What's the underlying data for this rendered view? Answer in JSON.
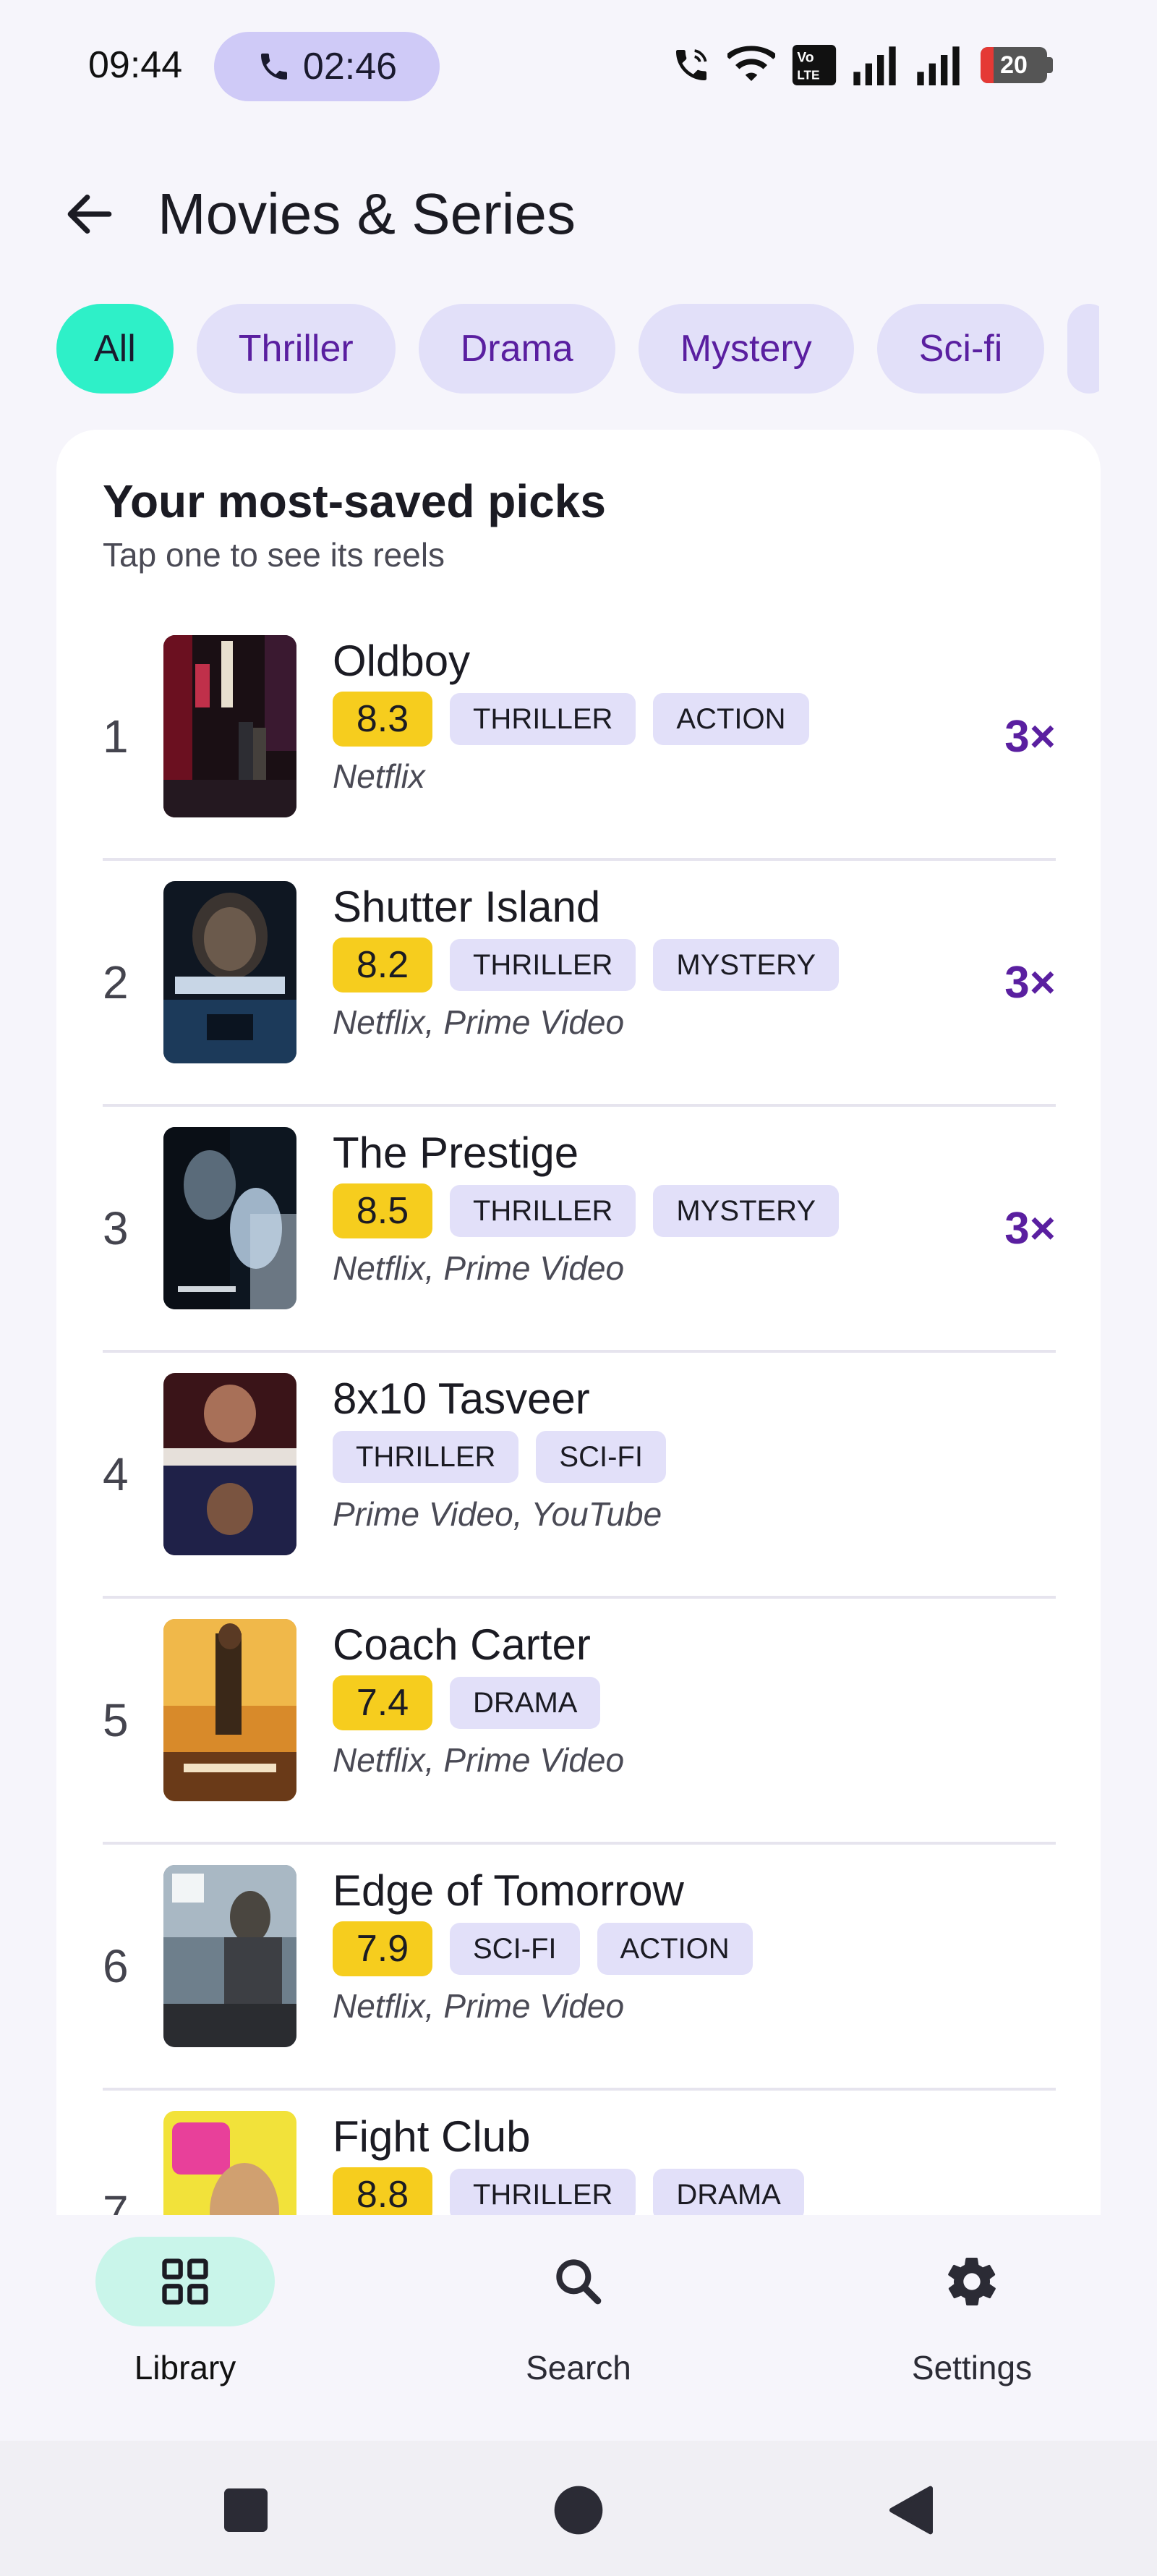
{
  "status_bar": {
    "time": "09:44",
    "call_timer": "02:46",
    "battery_level": "20",
    "battery_percent": 20,
    "colors": {
      "call_pill": "#cfcaf7",
      "battery_low": "#e53935"
    }
  },
  "header": {
    "title": "Movies & Series",
    "back_icon": "arrow-left-icon"
  },
  "filters": {
    "chips": [
      {
        "label": "All",
        "active": true
      },
      {
        "label": "Thriller",
        "active": false
      },
      {
        "label": "Drama",
        "active": false
      },
      {
        "label": "Mystery",
        "active": false
      },
      {
        "label": "Sci-fi",
        "active": false
      }
    ],
    "colors": {
      "active": "#2ef0c8",
      "inactive": "#e2e0f9",
      "text": "#5a1fa0"
    }
  },
  "card": {
    "title": "Your most-saved picks",
    "subtitle": "Tap one to see its reels"
  },
  "movies": [
    {
      "rank": "1",
      "title": "Oldboy",
      "rating": "8.3",
      "tags": [
        "THRILLER",
        "ACTION"
      ],
      "providers": "Netflix",
      "saves": "3×"
    },
    {
      "rank": "2",
      "title": "Shutter Island",
      "rating": "8.2",
      "tags": [
        "THRILLER",
        "MYSTERY"
      ],
      "providers": "Netflix, Prime Video",
      "saves": "3×"
    },
    {
      "rank": "3",
      "title": "The Prestige",
      "rating": "8.5",
      "tags": [
        "THRILLER",
        "MYSTERY"
      ],
      "providers": "Netflix, Prime Video",
      "saves": "3×"
    },
    {
      "rank": "4",
      "title": "8x10 Tasveer",
      "rating": "",
      "tags": [
        "THRILLER",
        "SCI-FI"
      ],
      "providers": "Prime Video, YouTube",
      "saves": ""
    },
    {
      "rank": "5",
      "title": "Coach Carter",
      "rating": "7.4",
      "tags": [
        "DRAMA"
      ],
      "providers": "Netflix, Prime Video",
      "saves": ""
    },
    {
      "rank": "6",
      "title": "Edge of Tomorrow",
      "rating": "7.9",
      "tags": [
        "SCI-FI",
        "ACTION"
      ],
      "providers": "Netflix, Prime Video",
      "saves": ""
    },
    {
      "rank": "7",
      "title": "Fight Club",
      "rating": "8.8",
      "tags": [
        "THRILLER",
        "DRAMA"
      ],
      "providers": "",
      "saves": ""
    }
  ],
  "bottom_nav": {
    "items": [
      {
        "label": "Library",
        "icon": "grid-icon",
        "active": true
      },
      {
        "label": "Search",
        "icon": "search-icon",
        "active": false
      },
      {
        "label": "Settings",
        "icon": "gear-icon",
        "active": false
      }
    ]
  },
  "system_nav": {
    "icons": [
      "recents-square-icon",
      "home-circle-icon",
      "back-triangle-icon"
    ]
  },
  "colors": {
    "rating_badge": "#f6cd1e",
    "tag_bg": "#e2e0f9",
    "saves_text": "#5a1fa0",
    "nav_active": "#c9f5ea"
  }
}
